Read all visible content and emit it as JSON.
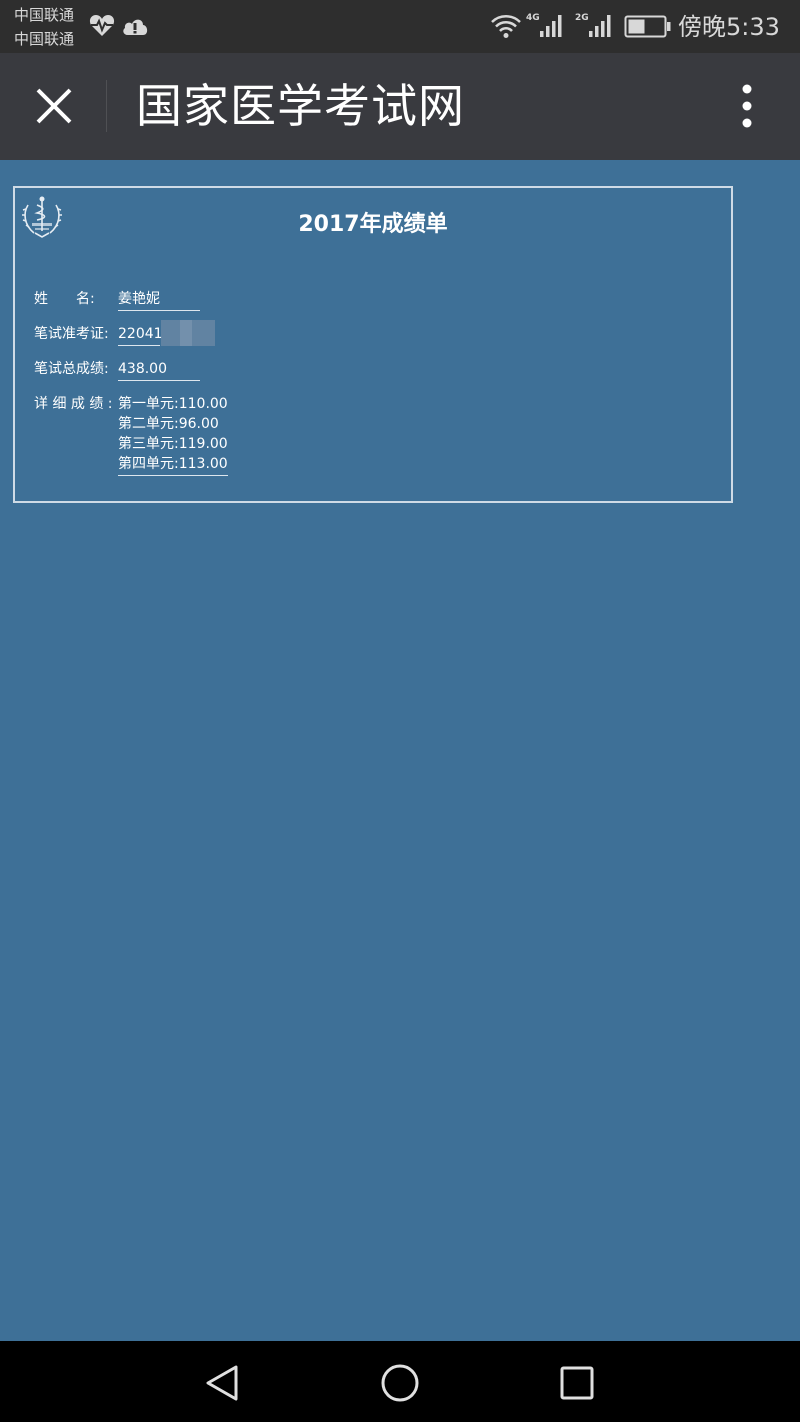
{
  "status_bar": {
    "carrier_1": "中国联通",
    "carrier_2": "中国联通",
    "network_1": "4G",
    "network_2": "2G",
    "time": "傍晚5:33",
    "icons": [
      "heart-rate-icon",
      "cloud-icon",
      "wifi-icon",
      "signal-4g-icon",
      "signal-2g-icon",
      "battery-icon"
    ]
  },
  "title_bar": {
    "title": "国家医学考试网",
    "close_icon": "close-icon",
    "more_icon": "more-vertical-icon"
  },
  "certificate": {
    "title": "2017年成绩单",
    "emblem_icon": "medical-emblem-icon",
    "fields": {
      "name_label": "姓　　名:",
      "name_value": "姜艳妮",
      "exam_id_label": "笔试准考证:",
      "exam_id_value": "22041",
      "total_label": "笔试总成绩:",
      "total_value": "438.00",
      "detail_label": "详 细 成 绩 :"
    },
    "details": [
      "第一单元:110.00",
      "第二单元:96.00",
      "第三单元:119.00",
      "第四单元:113.00"
    ]
  },
  "nav_bar": {
    "icons": [
      "back-icon",
      "home-icon",
      "recent-apps-icon"
    ]
  },
  "colors": {
    "page_background": "#3e7097",
    "status_bar": "#2e2e2e",
    "title_bar": "#393a3f",
    "nav_bar": "#000000"
  }
}
